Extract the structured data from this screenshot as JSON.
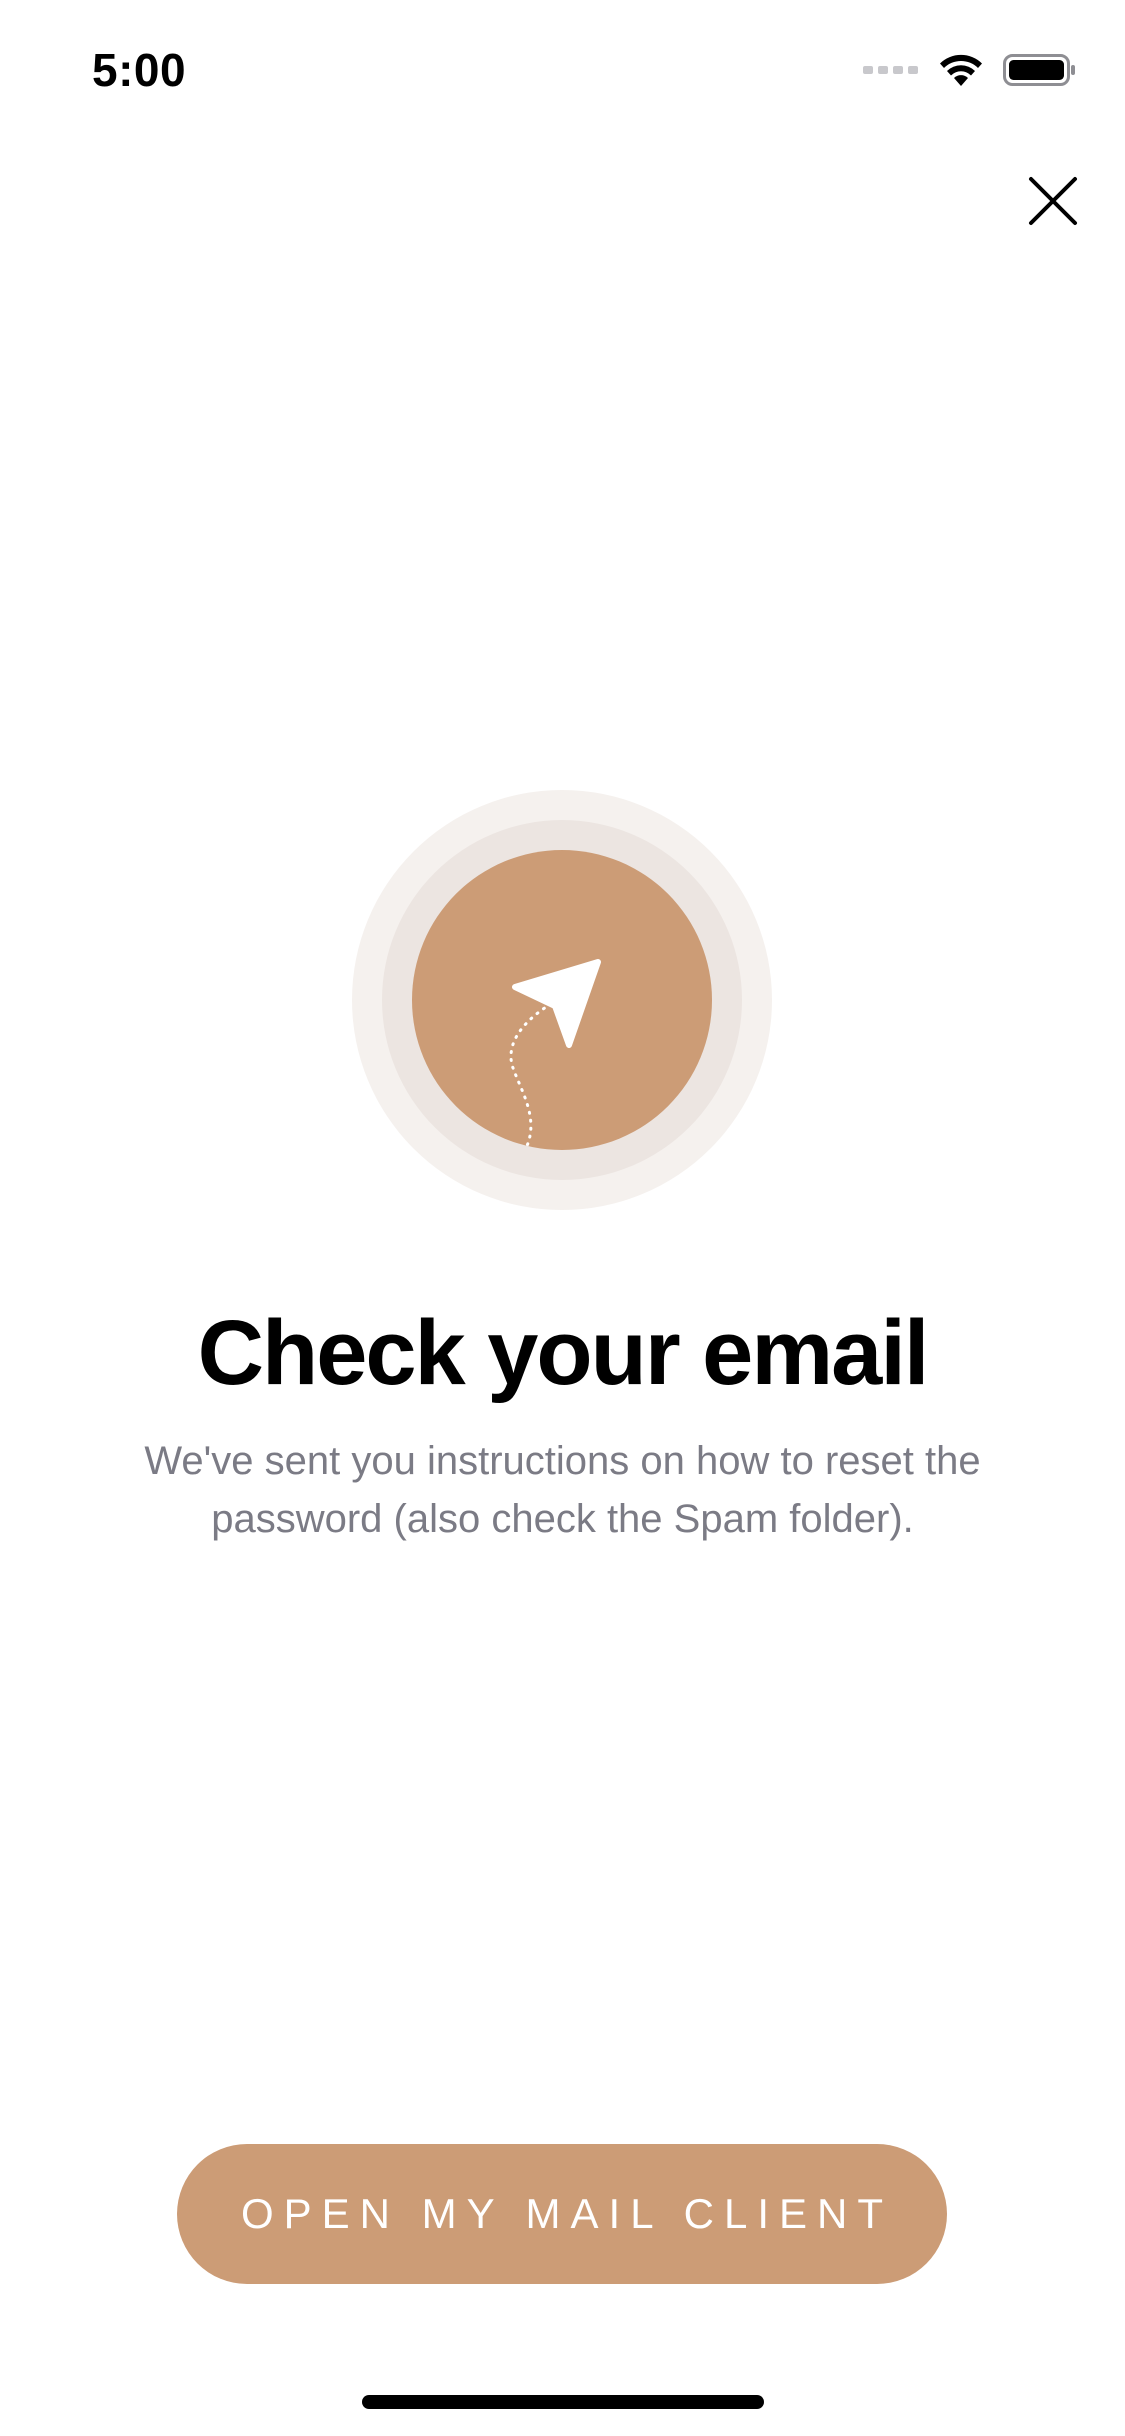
{
  "status_bar": {
    "time": "5:00",
    "icons": [
      "cellular-signal-icon",
      "wifi-icon",
      "battery-icon"
    ]
  },
  "header": {
    "close_icon": "close-icon"
  },
  "hero": {
    "icon": "paper-plane-icon"
  },
  "content": {
    "title": "Check your email",
    "subtitle": "We've sent you instructions on how to reset the password (also check the Spam folder)."
  },
  "cta": {
    "label": "OPEN MY MAIL CLIENT"
  },
  "colors": {
    "accent": "#cc9c76",
    "ring_outer": "#f5f1ee",
    "ring_middle": "#ece5e1",
    "subtitle": "#7b7b85"
  }
}
